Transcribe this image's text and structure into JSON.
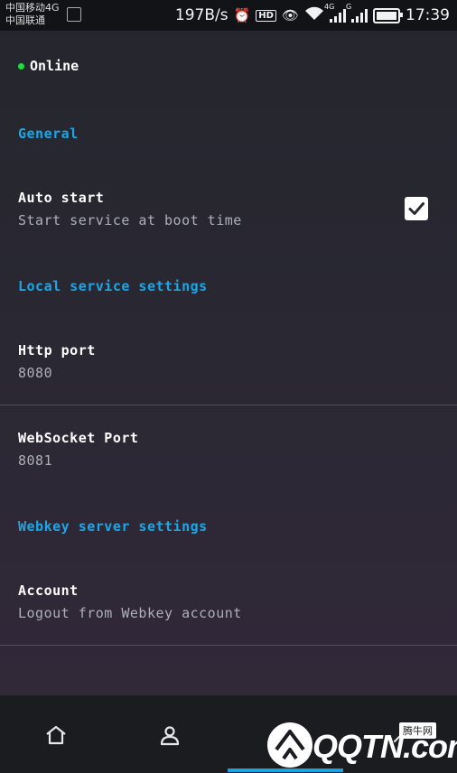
{
  "statusbar": {
    "carrier1": "中国移动4G",
    "carrier2": "中国联通",
    "speed": "197B/s",
    "hd": "HD",
    "net1": "4G",
    "net2": "G",
    "time": "17:39"
  },
  "status": {
    "text": "Online",
    "color": "#1fdc3c"
  },
  "sections": {
    "general": "General",
    "local": "Local service settings",
    "webkey": "Webkey server settings"
  },
  "prefs": {
    "autostart": {
      "title": "Auto start",
      "summary": "Start service at boot time",
      "checked": true
    },
    "http": {
      "title": "Http port",
      "value": "8080"
    },
    "websocket": {
      "title": "WebSocket Port",
      "value": "8081"
    },
    "account": {
      "title": "Account",
      "summary": "Logout from Webkey account"
    }
  },
  "bottom_nav": {
    "items": [
      "home-icon",
      "person-icon",
      "settings-icon",
      "tools-icon"
    ],
    "selected_index": 2,
    "accent": "#19a3e3"
  },
  "watermark": {
    "brand": "QQTN.com",
    "badge": "腾牛网"
  }
}
